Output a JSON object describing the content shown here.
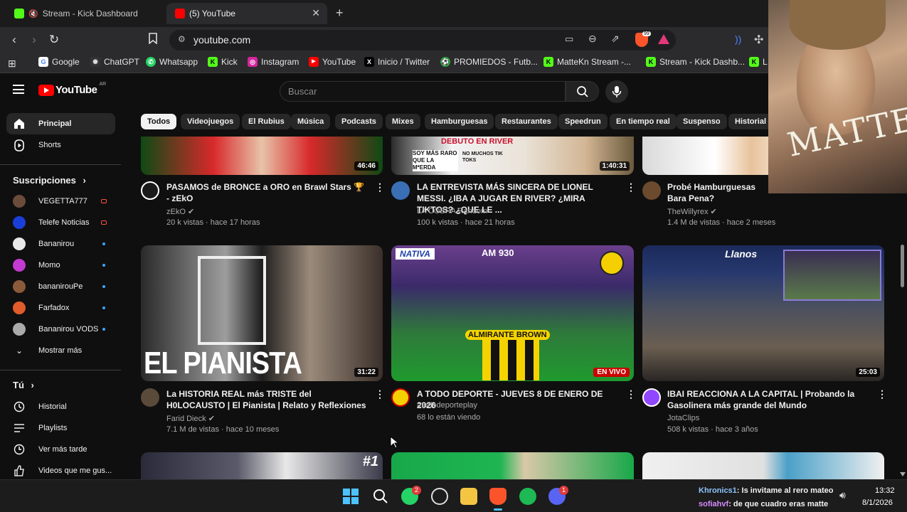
{
  "browser": {
    "tabs": [
      {
        "label": "Stream - Kick Dashboard"
      },
      {
        "label": "(5) YouTube"
      }
    ],
    "new_tab_label": "+",
    "close_label": "✕",
    "url": "youtube.com",
    "shields_badge": "99",
    "bookmarks": [
      {
        "label": "Google",
        "color": "#4285f4",
        "glyph": "G"
      },
      {
        "label": "ChatGPT",
        "color": "#bbbbbb",
        "glyph": "✺"
      },
      {
        "label": "Whatsapp",
        "color": "#25d366",
        "glyph": "✆"
      },
      {
        "label": "Kick",
        "color": "#53fc18",
        "glyph": "K"
      },
      {
        "label": "Instagram",
        "color": "#d6249f",
        "glyph": "◎"
      },
      {
        "label": "YouTube",
        "color": "#ff0000",
        "glyph": "▶"
      },
      {
        "label": "Inicio / Twitter",
        "color": "#ffffff",
        "glyph": "X"
      },
      {
        "label": "PROMIEDOS - Futb...",
        "color": "#2e9e3e",
        "glyph": "⚽"
      },
      {
        "label": "MatteKn Stream -...",
        "color": "#53fc18",
        "glyph": "K"
      },
      {
        "label": "Stream - Kick Dashb...",
        "color": "#53fc18",
        "glyph": "K"
      },
      {
        "label": "L",
        "color": "#53fc18",
        "glyph": "K"
      }
    ]
  },
  "youtube": {
    "logo_text": "YouTube",
    "region": "AR",
    "search_placeholder": "Buscar",
    "sidebar": {
      "main": [
        {
          "label": "Principal",
          "icon": "home-icon"
        },
        {
          "label": "Shorts",
          "icon": "shorts-icon"
        }
      ],
      "subs_header": "Suscripciones",
      "subs": [
        {
          "label": "VEGETTA777",
          "color": "#6b4b3a",
          "status": "live"
        },
        {
          "label": "Telefe Noticias",
          "color": "#1a3fd8",
          "status": "live"
        },
        {
          "label": "Bananirou",
          "color": "#e8e8e8",
          "status": "dot"
        },
        {
          "label": "Momo",
          "color": "#c23ad1",
          "status": "dot"
        },
        {
          "label": "bananirouPe",
          "color": "#8a5a3a",
          "status": "dot"
        },
        {
          "label": "Farfadox",
          "color": "#e25b2a",
          "status": "dot"
        },
        {
          "label": "Bananirou VODS",
          "color": "#aaaaaa",
          "status": "dot"
        }
      ],
      "show_more": "Mostrar más",
      "you_header": "Tú",
      "you": [
        {
          "label": "Historial",
          "icon": "history-icon"
        },
        {
          "label": "Playlists",
          "icon": "playlists-icon"
        },
        {
          "label": "Ver más tarde",
          "icon": "watch-later-icon"
        },
        {
          "label": "Videos que me gus...",
          "icon": "liked-icon"
        }
      ]
    },
    "chips": [
      "Todos",
      "Videojuegos",
      "El Rubius",
      "Música",
      "Podcasts",
      "Mixes",
      "Hamburguesas",
      "Restaurantes",
      "Speedrun",
      "En tiempo real",
      "Suspenso",
      "Historial"
    ],
    "videos_row1": [
      {
        "title": "PASAMOS de BRONCE a ORO en Brawl Stars 🏆 - zEkO",
        "channel": "zEkO",
        "meta": "20 k vistas · hace 17 horas",
        "duration": "46:46",
        "verified": true
      },
      {
        "title": "LA ENTREVISTA MÁS SINCERA DE LIONEL MESSI. ¿IBA A JUGAR EN RIVER? ¿MIRA TIKTOS? ¿QUE LE ...",
        "channel": "LA COBRA Random",
        "meta": "100 k vistas · hace 21 horas",
        "duration": "1:40:31",
        "verified": false
      },
      {
        "title": "Probé Hamburguesas Bara Pena?",
        "channel": "TheWillyrex",
        "meta": "1.4 M de vistas · hace 2 meses",
        "duration": "",
        "verified": true
      }
    ],
    "thumb_texts": {
      "messi_a": "SOY MÁS RARO QUE LA M*ERDA",
      "messi_b": "NO MUCHOS TIK TOKS",
      "messi_c": "DEBUTO EN RIVER",
      "pianista": "EL PIANISTA",
      "nativa": "NATIVA",
      "am930": "AM 930",
      "almirante": "ALMIRANTE BROWN",
      "llanos": "Llanos",
      "rank": "#1"
    },
    "videos_row2": [
      {
        "title": "La HISTORIA REAL más TRISTE del H0LOCAUSTO | El Pianista | Relato y Reflexiones",
        "channel": "Farid Dieck",
        "meta": "7.1 M de vistas · hace 10 meses",
        "duration": "31:22",
        "verified": true
      },
      {
        "title": "A TODO DEPORTE - JUEVES 8 DE ENERO DE 2026",
        "channel": "atododeporteplay",
        "meta": "68 lo están viendo",
        "live": "EN VIVO",
        "verified": false
      },
      {
        "title": "IBAI REACCIONA A LA CAPITAL | Probando la Gasolinera más grande del Mundo",
        "channel": "JotaClips",
        "meta": "508 k vistas · hace 3 años",
        "duration": "25:03",
        "verified": false
      }
    ]
  },
  "webcam": {
    "caption": "MATTE"
  },
  "taskbar": {
    "apps": [
      "windows-start",
      "search",
      "whatsapp",
      "chrome-like",
      "file-explorer",
      "brave",
      "spotify",
      "discord"
    ],
    "whatsapp_badge": "2",
    "discord_badge": "1",
    "chat": [
      {
        "user": "Khronics1",
        "text": ": Is invitame al rero mateo"
      },
      {
        "user": "sofiahvf",
        "text": ": de que cuadro eras matte"
      }
    ],
    "time": "13:32",
    "date": "8/1/2026"
  }
}
